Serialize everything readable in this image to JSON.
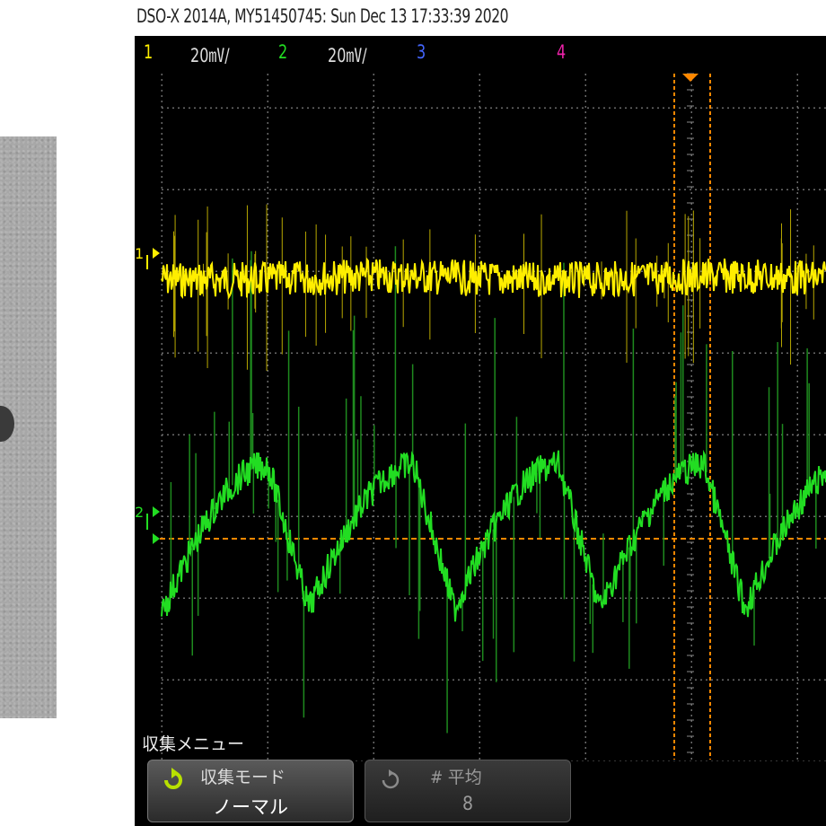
{
  "title": "DSO-X 2014A, MY51450745: Sun Dec 13 17:33:39 2020",
  "channels": [
    {
      "label": "1",
      "scale": "20㎷/",
      "color": "#ffee00"
    },
    {
      "label": "2",
      "scale": "20㎷/",
      "color": "#22dd22"
    },
    {
      "label": "3",
      "scale": "",
      "color": "#4466ff"
    },
    {
      "label": "4",
      "scale": "",
      "color": "#ee22aa"
    }
  ],
  "markers": {
    "ch1": "1",
    "ch2": "2"
  },
  "menu": {
    "title": "収集メニュー",
    "acq_mode": {
      "label": "収集モード",
      "value": "ノーマル",
      "icon": "refresh-arrow-icon"
    },
    "averages": {
      "label": "# 平均",
      "value": "8",
      "icon": "refresh-arrow-icon"
    }
  },
  "colors": {
    "trace1": "#ffee00",
    "trace2": "#22dd22",
    "cursor": "#ff8800",
    "grid": "#777777"
  }
}
